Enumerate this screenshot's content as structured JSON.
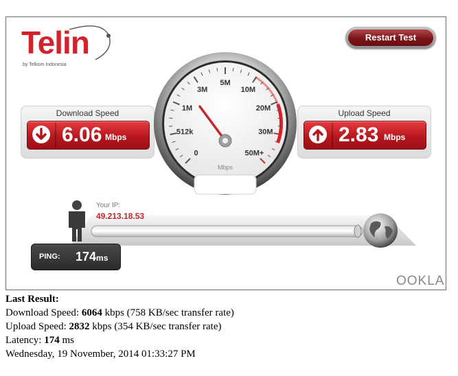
{
  "brand": {
    "name": "Telin",
    "sub": "by Telkom Indonesia",
    "vendor": "OOKLA",
    "accent": "#c1272d"
  },
  "toolbar": {
    "restart_label": "Restart Test"
  },
  "download": {
    "title": "Download Speed",
    "value": "6.06",
    "unit": "Mbps",
    "icon": "arrow-down-icon"
  },
  "upload": {
    "title": "Upload Speed",
    "value": "2.83",
    "unit": "Mbps",
    "icon": "arrow-up-icon"
  },
  "gauge": {
    "unit": "Mbps",
    "needle_value": 2.83,
    "ticks": [
      "0",
      "512k",
      "1M",
      "3M",
      "5M",
      "10M",
      "20M",
      "30M",
      "50M+"
    ]
  },
  "network": {
    "ip_label": "Your IP:",
    "ip": "49.213.18.53"
  },
  "ping": {
    "label": "PING:",
    "value": "174",
    "unit": "ms"
  },
  "result": {
    "heading": "Last Result:",
    "download_prefix": "Download Speed: ",
    "download_kbps": "6064",
    "download_suffix": " kbps (758 KB/sec transfer rate)",
    "upload_prefix": "Upload Speed: ",
    "upload_kbps": "2832",
    "upload_suffix": " kbps (354 KB/sec transfer rate)",
    "latency_prefix": "Latency: ",
    "latency": "174",
    "latency_suffix": " ms",
    "timestamp": "Wednesday, 19 November, 2014 01:33:27 PM"
  }
}
